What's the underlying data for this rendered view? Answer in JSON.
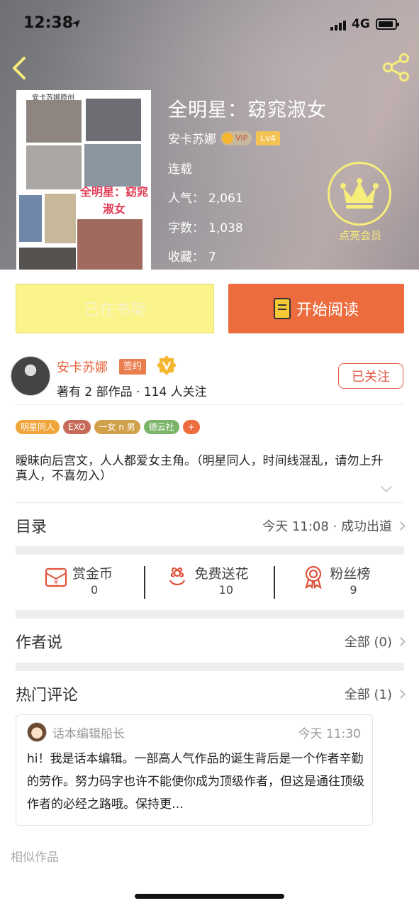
{
  "status_bar": {
    "time": "12:38",
    "network": "4G"
  },
  "book": {
    "title": "全明星：窈窕淑女",
    "author": "安卡苏娜",
    "vip_label": "VIP",
    "level": "Lv4",
    "status": "连载",
    "popularity_label": "人气：",
    "popularity": "2,061",
    "word_count_label": "字数：",
    "word_count": "1,038",
    "favorites_label": "收藏：",
    "favorites": "7",
    "cover_header": "安卡苏娜原创",
    "cover_title": "全明星：窈窕淑女"
  },
  "member": {
    "label": "点亮会员",
    "accent": "#f7ed7a"
  },
  "actions": {
    "shelf_label": "已在书架",
    "read_label": "开始阅读",
    "read_color": "#ec6c3e",
    "shelf_color": "#fbf48a"
  },
  "author_card": {
    "name": "安卡苏娜",
    "sign_tag": "签约",
    "stats": "著有 2 部作品 · 114 人关注",
    "follow_label": "已关注"
  },
  "tags": [
    {
      "label": "明星同人",
      "color": "#f0a53a"
    },
    {
      "label": "EXO",
      "color": "#c86a5a"
    },
    {
      "label": "一女 n 男",
      "color": "#d1a04a"
    },
    {
      "label": "德云社",
      "color": "#7bb46a"
    },
    {
      "label": "+",
      "color": "#ec6c3e"
    }
  ],
  "description": "暧昧向后宫文，人人都爱女主角。（明星同人，时间线混乱，请勿上升真人，不喜勿入）",
  "catalog": {
    "label": "目录",
    "latest": "今天 11:08 · 成功出道"
  },
  "stats": [
    {
      "name": "赏金币",
      "value": "0",
      "icon": "coin-envelope-icon"
    },
    {
      "name": "免费送花",
      "value": "10",
      "icon": "flower-icon"
    },
    {
      "name": "粉丝榜",
      "value": "9",
      "icon": "ribbon-badge-icon"
    }
  ],
  "author_says": {
    "label": "作者说",
    "right": "全部 (0)"
  },
  "hot_comments": {
    "label": "热门评论",
    "right": "全部 (1)"
  },
  "review": {
    "name": "话本编辑船长",
    "time": "今天 11:30",
    "text": "hi！我是话本编辑。一部高人气作品的诞生背后是一个作者辛勤的劳作。努力码字也许不能使你成为顶级作者，但这是通往顶级作者的必经之路哦。保持更…"
  },
  "similar_label": "相似作品"
}
